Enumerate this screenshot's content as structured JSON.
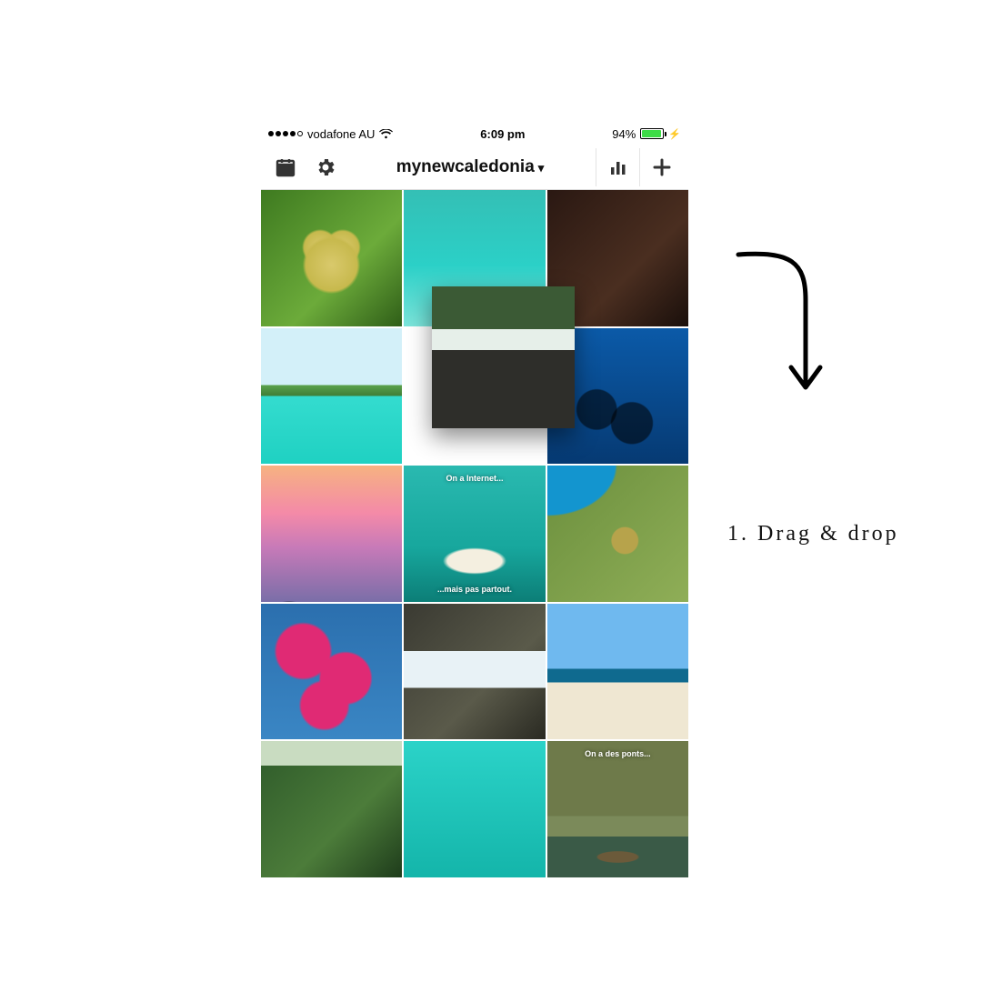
{
  "statusbar": {
    "carrier": "vodafone AU",
    "time": "6:09 pm",
    "battery_pct": "94%"
  },
  "toolbar": {
    "account_name": "mynewcaledonia"
  },
  "grid": {
    "tiles": [
      {
        "name": "heart-shaped-field"
      },
      {
        "name": "paddleboard-lagoon"
      },
      {
        "name": "dark-interior"
      },
      {
        "name": "island-lagoon"
      },
      {
        "name": "empty-slot"
      },
      {
        "name": "diver-underwater-bike"
      },
      {
        "name": "sunset-palm"
      },
      {
        "name": "sandbar-aerial",
        "caption_top": "On a Internet...",
        "caption_bottom": "...mais pas partout."
      },
      {
        "name": "heart-mangrove-aerial"
      },
      {
        "name": "bougainvillea-flowers"
      },
      {
        "name": "rocky-waterfall"
      },
      {
        "name": "beach-person"
      },
      {
        "name": "jungle-waterfall"
      },
      {
        "name": "clear-turquoise-water"
      },
      {
        "name": "river-paddleboard",
        "caption_top": "On a des ponts..."
      }
    ],
    "dragged_tile": {
      "name": "rocks-and-waterfall"
    }
  },
  "annotation": {
    "step_text": "1. Drag & drop"
  }
}
